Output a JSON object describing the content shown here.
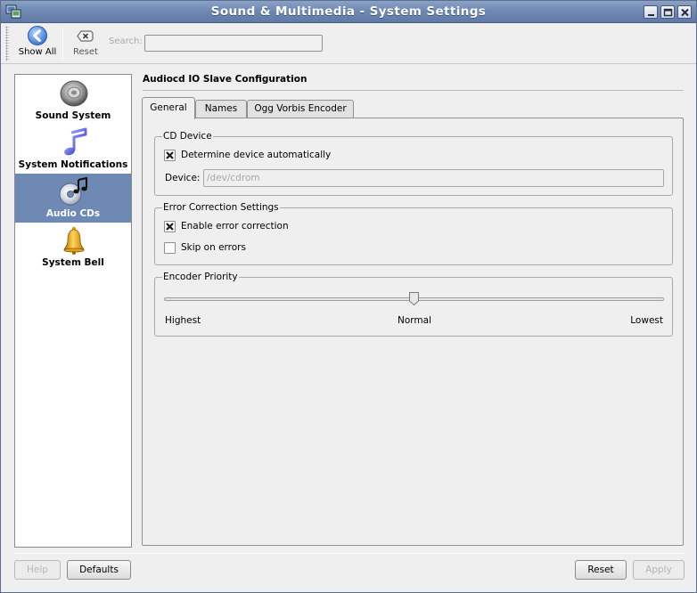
{
  "window": {
    "title": "Sound & Multimedia - System Settings",
    "icons": {
      "app": "computer-settings-icon",
      "minimize": "minimize-icon",
      "maximize": "maximize-icon",
      "close": "close-icon"
    }
  },
  "toolbar": {
    "show_all_label": "Show All",
    "reset_label": "Reset",
    "search_label": "Search:",
    "search_value": "",
    "icons": {
      "show_all": "back-arrow-icon",
      "reset": "reset-icon"
    }
  },
  "sidebar": {
    "items": [
      {
        "label": "Sound System",
        "icon": "speaker-icon",
        "selected": false
      },
      {
        "label": "System Notifications",
        "icon": "music-note-icon",
        "selected": false
      },
      {
        "label": "Audio CDs",
        "icon": "audio-cd-icon",
        "selected": true
      },
      {
        "label": "System Bell",
        "icon": "bell-icon",
        "selected": false
      }
    ]
  },
  "page": {
    "title": "Audiocd IO Slave Configuration",
    "tabs": [
      {
        "label": "General",
        "active": true
      },
      {
        "label": "Names",
        "active": false
      },
      {
        "label": "Ogg Vorbis Encoder",
        "active": false
      }
    ],
    "cd_device": {
      "title": "CD Device",
      "auto_label": "Determine device automatically",
      "auto_checked": true,
      "device_label": "Device:",
      "device_value": "/dev/cdrom"
    },
    "error_correction": {
      "title": "Error Correction Settings",
      "enable_label": "Enable error correction",
      "enable_checked": true,
      "skip_label": "Skip on errors",
      "skip_checked": false
    },
    "encoder_priority": {
      "title": "Encoder Priority",
      "levels": [
        "Highest",
        "Normal",
        "Lowest"
      ],
      "value_fraction": 0.5
    }
  },
  "footer": {
    "help_label": "Help",
    "defaults_label": "Defaults",
    "reset_label": "Reset",
    "apply_label": "Apply"
  },
  "colors": {
    "title_bar": "#6f89b3",
    "selection": "#6d89b4",
    "window_bg": "#efefef"
  }
}
